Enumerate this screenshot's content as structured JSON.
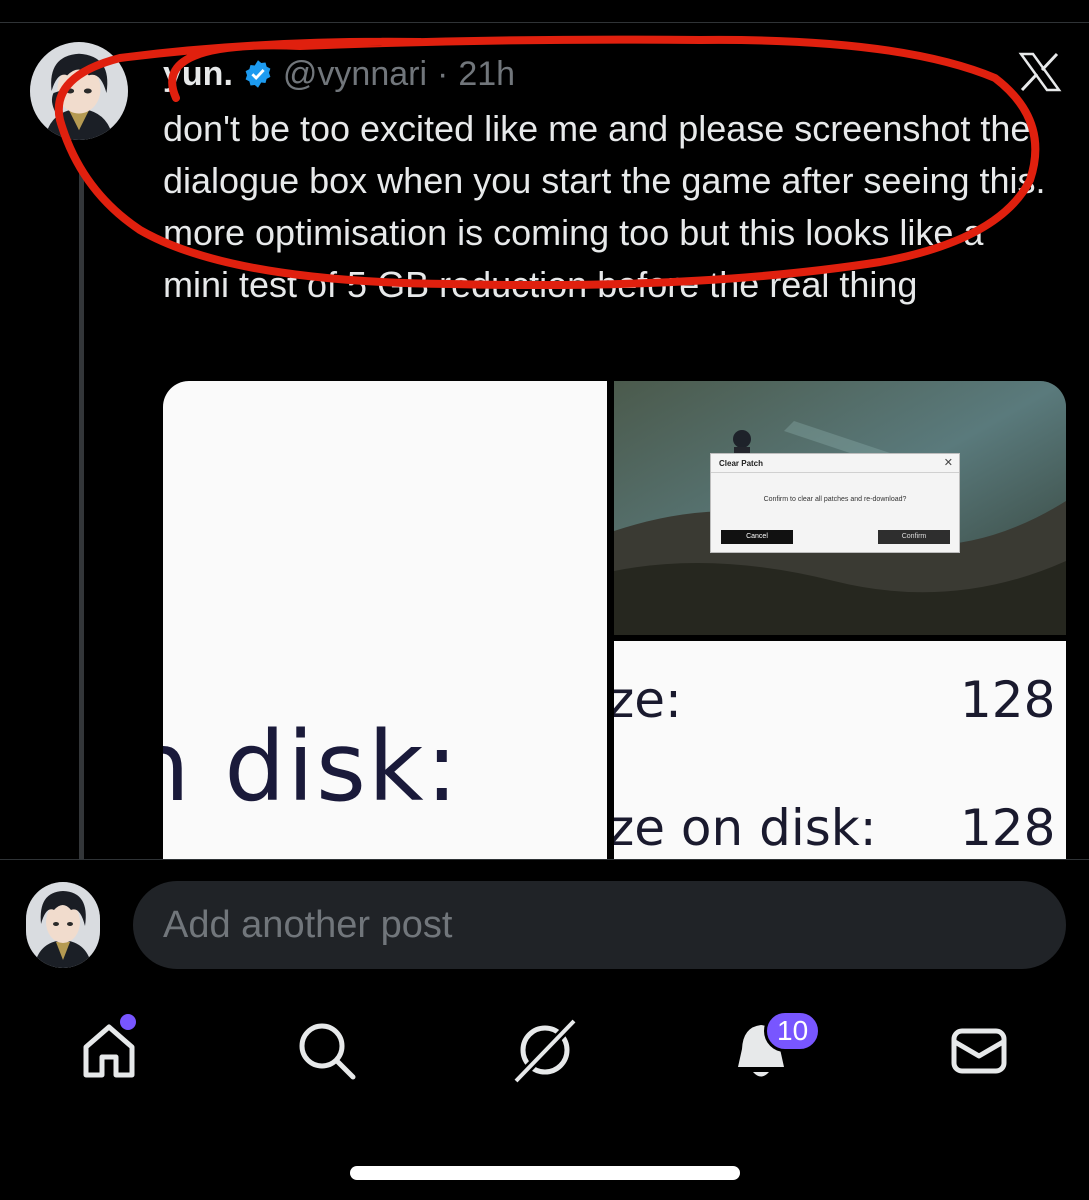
{
  "post": {
    "display_name": "yun.",
    "handle": "@vynnari",
    "separator": "·",
    "time": "21h",
    "text": "don't be too excited like me and please screenshot the dialogue box when you start the game after seeing this. more optimisation is coming too but this looks like a mini test of 5 GB reduction before the real thing",
    "media": {
      "left_text": "n disk:",
      "right_bottom_line1_label": "ze:",
      "right_bottom_line1_value": "128",
      "right_bottom_line2_label": "ze on disk:",
      "right_bottom_line2_value": "128",
      "dialog": {
        "title": "Clear Patch",
        "close": "✕",
        "message": "Confirm to clear all patches and re-download?",
        "cancel_label": "Cancel",
        "confirm_label": "Confirm"
      }
    }
  },
  "reply": {
    "placeholder": "Add another post"
  },
  "nav": {
    "items": [
      "home",
      "search",
      "grok",
      "notifications",
      "messages"
    ],
    "notifications_count": "10"
  },
  "colors": {
    "background": "#000000",
    "text_primary": "#e7e9ea",
    "text_secondary": "#71767b",
    "accent_badge": "#7856ff",
    "annotation_red": "#e0200e",
    "verified_blue": "#1d9bf0"
  }
}
